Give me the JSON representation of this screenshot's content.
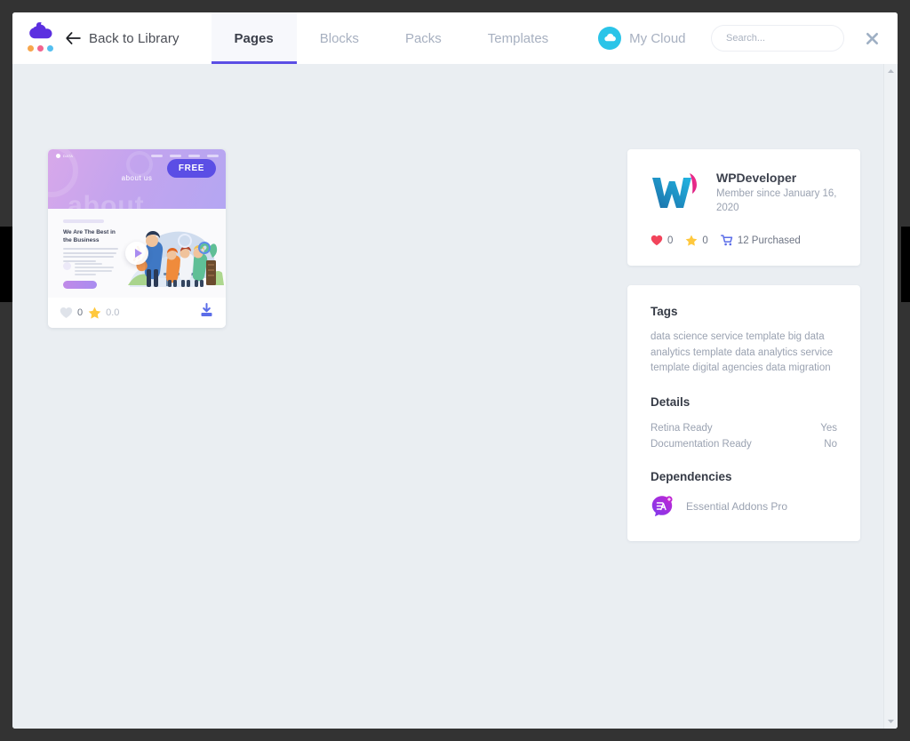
{
  "window": {
    "backdrop_color": "#333333",
    "modal_bg": "#eaeef2"
  },
  "header": {
    "logo": {
      "icon": "templately-cloud-logo",
      "dot_colors": [
        "#f7a64c",
        "#f2638f",
        "#54bff0"
      ],
      "cloud_color": "#5b2fe0"
    },
    "back": {
      "label": "Back to Library",
      "icon": "arrow-left-icon"
    },
    "tabs": [
      {
        "id": "pages",
        "label": "Pages",
        "active": true
      },
      {
        "id": "blocks",
        "label": "Blocks",
        "active": false
      },
      {
        "id": "packs",
        "label": "Packs",
        "active": false
      },
      {
        "id": "templates",
        "label": "Templates",
        "active": false
      },
      {
        "id": "my-cloud",
        "label": "My Cloud",
        "active": false,
        "icon": "cloud-icon",
        "icon_bg": "#2bc4e8"
      }
    ],
    "search": {
      "placeholder": "Search...",
      "value": ""
    },
    "close": {
      "icon": "close-icon",
      "label": "✕"
    },
    "active_tab_underline_color": "#5b4ee5"
  },
  "card": {
    "badge": "FREE",
    "badge_color": "#5b4ee5",
    "hero_title": "about us",
    "hero_ghost_word": "about",
    "body_eyebrow": "",
    "body_heading": "We Are The Best in the Business",
    "play_icon": "play-icon",
    "likes": {
      "icon": "heart-icon",
      "value": "0"
    },
    "rating": {
      "icon": "star-icon",
      "value": "0.0"
    },
    "download": {
      "icon": "download-icon",
      "color": "#5b6de8"
    }
  },
  "author_panel": {
    "logo_icon": "wpdeveloper-logo",
    "name": "WPDeveloper",
    "member_since": "Member since January 16, 2020",
    "stats": [
      {
        "icon": "heart-icon",
        "value": "0",
        "color": "#f2445b"
      },
      {
        "icon": "star-icon",
        "value": "0",
        "color": "#ffc83d"
      },
      {
        "icon": "cart-icon",
        "value": "12 Purchased",
        "color": "#5b6de8"
      }
    ]
  },
  "meta_panel": {
    "tags_title": "Tags",
    "tags_text": "data science service template big data analytics template data analytics service template digital agencies data migration",
    "details_title": "Details",
    "details": [
      {
        "label": "Retina Ready",
        "value": "Yes"
      },
      {
        "label": "Documentation Ready",
        "value": "No"
      }
    ],
    "dependencies_title": "Dependencies",
    "dependencies": [
      {
        "icon": "essential-addons-icon",
        "name": "Essential Addons Pro"
      }
    ]
  },
  "scrollbar": {
    "up_arrow": "scroll-up-arrow",
    "down_arrow": "scroll-down-arrow"
  }
}
